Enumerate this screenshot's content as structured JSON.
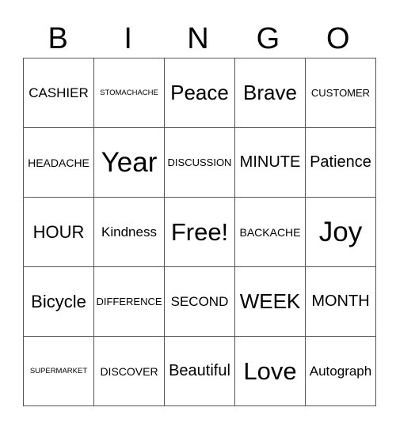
{
  "header": [
    "B",
    "I",
    "N",
    "G",
    "O"
  ],
  "rows": [
    [
      "CASHIER",
      "STOMACHACHE",
      "Peace",
      "Brave",
      "CUSTOMER"
    ],
    [
      "HEADACHE",
      "Year",
      "DISCUSSION",
      "MINUTE",
      "Patience"
    ],
    [
      "HOUR",
      "Kindness",
      "Free!",
      "BACKACHE",
      "Joy"
    ],
    [
      "Bicycle",
      "DIFFERENCE",
      "SECOND",
      "WEEK",
      "MONTH"
    ],
    [
      "SUPERMARKET",
      "DISCOVER",
      "Beautiful",
      "Love",
      "Autograph"
    ]
  ]
}
